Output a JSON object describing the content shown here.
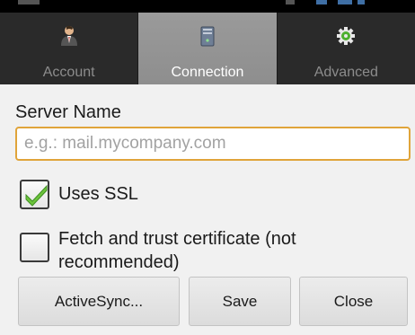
{
  "tabs": [
    {
      "label": "Account",
      "icon": "account-person-icon"
    },
    {
      "label": "Connection",
      "icon": "server-tower-icon"
    },
    {
      "label": "Advanced",
      "icon": "gear-icon"
    }
  ],
  "active_tab": "Connection",
  "form": {
    "server_label": "Server Name",
    "server_placeholder": "e.g.: mail.mycompany.com",
    "server_value": "",
    "ssl_label": "Uses SSL",
    "ssl_checked": true,
    "trust_label_line1": "Fetch and trust certificate (not",
    "trust_label_line2": "recommended)",
    "trust_checked": false
  },
  "buttons": {
    "activesync": "ActiveSync...",
    "save": "Save",
    "close": "Close"
  },
  "colors": {
    "accent_border": "#e0a43a",
    "check_green": "#6cc43b",
    "tab_bar": "#2a2a2a",
    "tab_active": "#949494"
  }
}
